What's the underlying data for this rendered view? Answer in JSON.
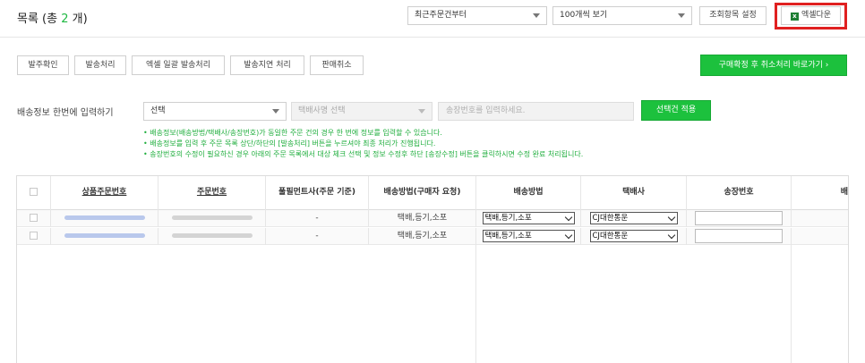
{
  "header": {
    "title_prefix": "목록 (총 ",
    "title_count": "2",
    "title_suffix": " 개)",
    "sort_select": "최근주문건부터",
    "page_size_select": "100개씩 보기",
    "column_settings_button": "조회항목 설정",
    "excel_icon_text": "x",
    "excel_download_button": "엑셀다운"
  },
  "actions": {
    "buttons": [
      "발주확인",
      "발송처리",
      "엑셀 일괄 발송처리",
      "발송지연 처리",
      "판매취소"
    ],
    "confirm_cancel_button": "구매확정 후 취소처리 바로가기 ›"
  },
  "bulk_shipping": {
    "label": "배송정보 한번에 입력하기",
    "method_select": "선택",
    "courier_select": "택배사명 선택",
    "tracking_placeholder": "송장번호를 입력하세요.",
    "apply_button": "선택건 적용",
    "notices": [
      "• 배송정보(배송방법/택배사/송장번호)가 동일한 주문 건의 경우 한 번에 정보를 입력할 수 있습니다.",
      "• 배송정보를 입력 후 주문 목록 상단/하단의 [발송처리] 버튼을 누르셔야 최종 처리가 진행됩니다.",
      "• 송장번호의 수정이 필요하신 경우 아래의 주문 목록에서 대상 체크 선택 및 정보 수정후 하단 [송장수정] 버튼을 클릭하시면 수정 완료 처리됩니다."
    ]
  },
  "table": {
    "headers": [
      "상품주문번호",
      "주문번호",
      "풀필먼트사(주문 기준)",
      "배송방법(구매자 요청)",
      "배송방법",
      "택배사",
      "송장번호",
      "배"
    ],
    "rows": [
      {
        "fulfillment": "-",
        "requested_method": "택배,등기,소포",
        "method": "택배,등기,소포",
        "courier": "CJ대한통운"
      },
      {
        "fulfillment": "-",
        "requested_method": "택배,등기,소포",
        "method": "택배,등기,소포",
        "courier": "CJ대한통운"
      }
    ]
  },
  "colors": {
    "accent_green": "#1cc13d",
    "highlight_red": "#e02020",
    "excel_green": "#1e7e34"
  }
}
